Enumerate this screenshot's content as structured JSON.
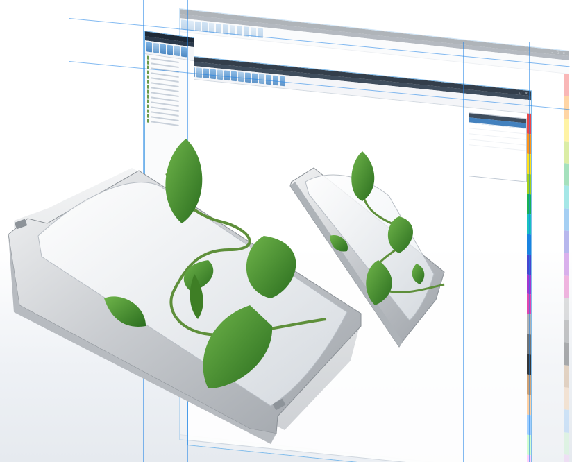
{
  "scene": {
    "background": "#ffffff",
    "accent": "#1e82e6",
    "leaf_color": "#3f8a2c"
  },
  "windows": [
    {
      "id": "back",
      "title": "",
      "menu": [],
      "company": ""
    },
    {
      "id": "middle",
      "title": "",
      "menu": [],
      "panel": {
        "header": "",
        "rows": []
      }
    },
    {
      "id": "front",
      "title": "",
      "menu": []
    }
  ],
  "palette_colors": [
    "#e33",
    "#f80",
    "#fd0",
    "#9c0",
    "#0a4",
    "#0bb",
    "#07d",
    "#33c",
    "#92c",
    "#d3a",
    "#aaa",
    "#666",
    "#222",
    "#c96",
    "#fc9",
    "#9cf",
    "#cfc",
    "#fcf"
  ]
}
